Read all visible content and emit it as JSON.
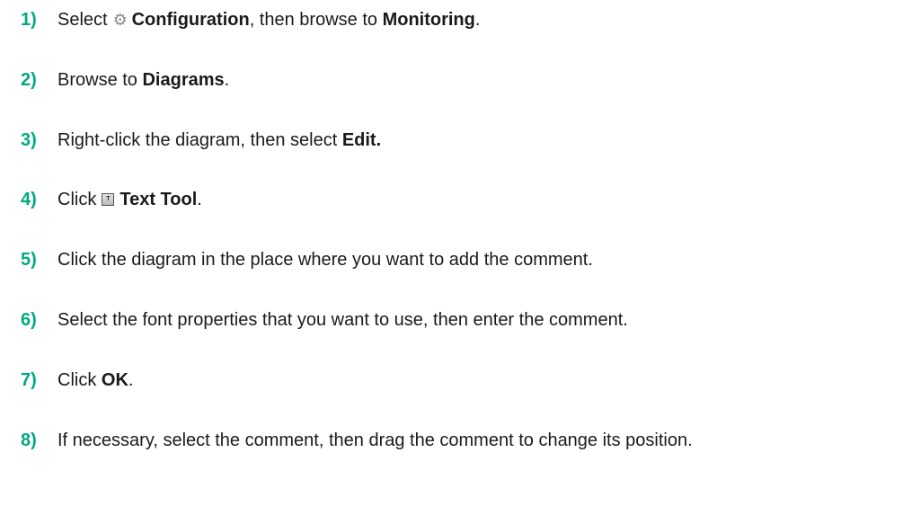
{
  "steps": [
    {
      "num": "1)",
      "parts": [
        "Select",
        "Configuration",
        ", then browse to ",
        "Monitoring",
        "."
      ],
      "icon": "gear-icon"
    },
    {
      "num": "2)",
      "parts": [
        "Browse to ",
        "Diagrams",
        "."
      ]
    },
    {
      "num": "3)",
      "parts": [
        "Right-click the diagram, then select ",
        "Edit."
      ]
    },
    {
      "num": "4)",
      "parts": [
        "Click",
        "Text Tool",
        "."
      ],
      "icon": "text-tool-icon",
      "icon_glyph": "T"
    },
    {
      "num": "5)",
      "parts": [
        "Click the diagram in the place where you want to add the comment."
      ]
    },
    {
      "num": "6)",
      "parts": [
        "Select the font properties that you want to use, then enter the comment."
      ]
    },
    {
      "num": "7)",
      "parts": [
        "Click ",
        "OK",
        "."
      ]
    },
    {
      "num": "8)",
      "parts": [
        "If necessary, select the comment, then drag the comment to change its position."
      ]
    }
  ],
  "colors": {
    "step_number": "#01a982",
    "text": "#1a1a1a",
    "icon_gray": "#8a8a8a"
  }
}
